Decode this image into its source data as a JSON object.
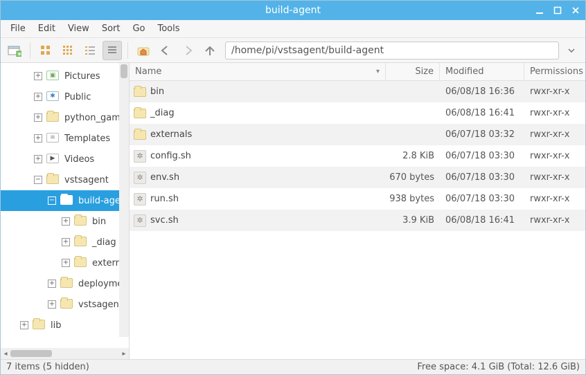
{
  "window": {
    "title": "build-agent"
  },
  "menu": {
    "file": "File",
    "edit": "Edit",
    "view": "View",
    "sort": "Sort",
    "go": "Go",
    "tools": "Tools"
  },
  "toolbar": {
    "path": "/home/pi/vstsagent/build-agent"
  },
  "tree": {
    "items": [
      {
        "label": "Pictures",
        "depth": 1,
        "expander": "+",
        "icon": "pictures",
        "selected": false
      },
      {
        "label": "Public",
        "depth": 1,
        "expander": "+",
        "icon": "public",
        "selected": false
      },
      {
        "label": "python_games",
        "depth": 1,
        "expander": "+",
        "icon": "folder",
        "selected": false
      },
      {
        "label": "Templates",
        "depth": 1,
        "expander": "+",
        "icon": "templates",
        "selected": false
      },
      {
        "label": "Videos",
        "depth": 1,
        "expander": "+",
        "icon": "videos",
        "selected": false
      },
      {
        "label": "vstsagent",
        "depth": 1,
        "expander": "−",
        "icon": "folder",
        "selected": false
      },
      {
        "label": "build-agent",
        "depth": 2,
        "expander": "−",
        "icon": "folder-open",
        "selected": true
      },
      {
        "label": "bin",
        "depth": 3,
        "expander": "+",
        "icon": "folder",
        "selected": false
      },
      {
        "label": "_diag",
        "depth": 3,
        "expander": "+",
        "icon": "folder",
        "selected": false
      },
      {
        "label": "externals",
        "depth": 3,
        "expander": "+",
        "icon": "folder",
        "selected": false
      },
      {
        "label": "deployment",
        "depth": 2,
        "expander": "+",
        "icon": "folder",
        "selected": false
      },
      {
        "label": "vstsagent",
        "depth": 2,
        "expander": "+",
        "icon": "folder",
        "selected": false
      },
      {
        "label": "lib",
        "depth": 0,
        "expander": "+",
        "icon": "folder",
        "selected": false
      }
    ]
  },
  "columns": {
    "name": "Name",
    "size": "Size",
    "modified": "Modified",
    "permissions": "Permissions"
  },
  "files": [
    {
      "name": "bin",
      "type": "folder",
      "size": "",
      "modified": "06/08/18 16:36",
      "perm": "rwxr-xr-x"
    },
    {
      "name": "_diag",
      "type": "folder",
      "size": "",
      "modified": "06/08/18 16:41",
      "perm": "rwxr-xr-x"
    },
    {
      "name": "externals",
      "type": "folder",
      "size": "",
      "modified": "06/07/18 03:32",
      "perm": "rwxr-xr-x"
    },
    {
      "name": "config.sh",
      "type": "script",
      "size": "2.8 KiB",
      "modified": "06/07/18 03:30",
      "perm": "rwxr-xr-x"
    },
    {
      "name": "env.sh",
      "type": "script",
      "size": "670 bytes",
      "modified": "06/07/18 03:30",
      "perm": "rwxr-xr-x"
    },
    {
      "name": "run.sh",
      "type": "script",
      "size": "938 bytes",
      "modified": "06/07/18 03:30",
      "perm": "rwxr-xr-x"
    },
    {
      "name": "svc.sh",
      "type": "script",
      "size": "3.9 KiB",
      "modified": "06/08/18 16:41",
      "perm": "rwxr-xr-x"
    }
  ],
  "status": {
    "left": "7 items (5 hidden)",
    "right": "Free space: 4.1 GiB (Total: 12.6 GiB)"
  }
}
